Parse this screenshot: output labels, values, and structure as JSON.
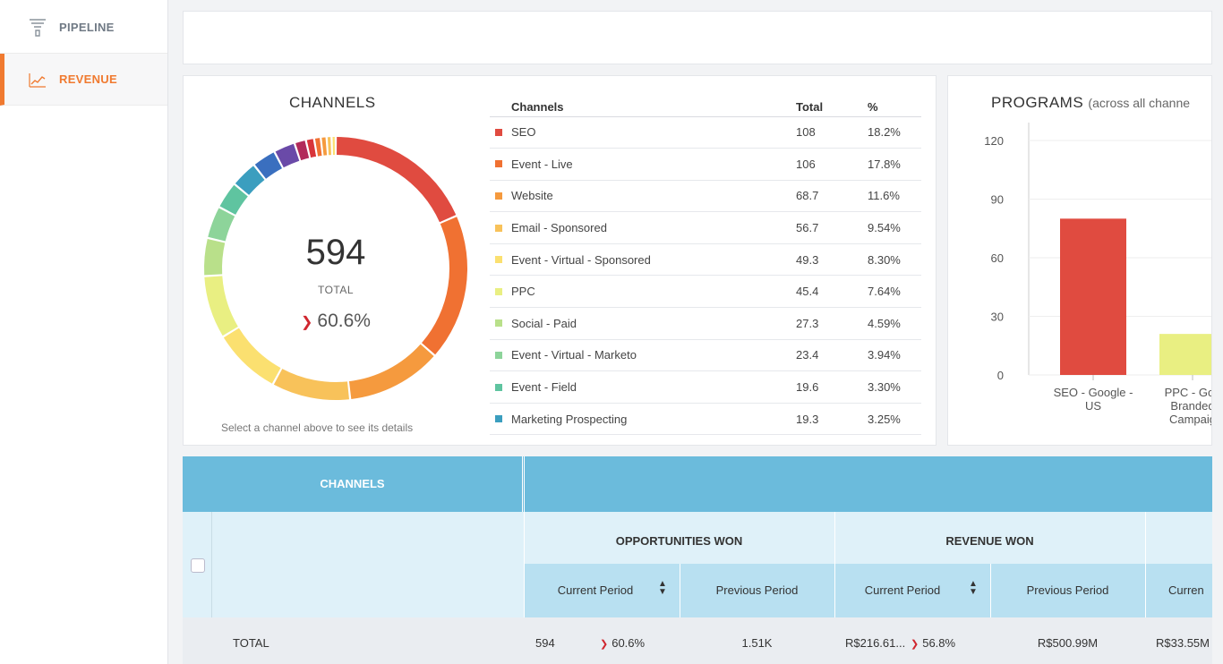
{
  "sidebar": {
    "items": [
      {
        "label": "PIPELINE",
        "icon": "funnel-icon"
      },
      {
        "label": "REVENUE",
        "icon": "trend-line-icon",
        "active": true
      }
    ]
  },
  "channels_card": {
    "title": "CHANNELS",
    "total_value": "594",
    "total_label": "TOTAL",
    "change": "60.6%",
    "change_direction": "down",
    "hint": "Select a channel above to see its details",
    "table_headers": {
      "channel": "Channels",
      "total": "Total",
      "pct": "%"
    },
    "rows": [
      {
        "name": "SEO",
        "total": "108",
        "pct": "18.2%",
        "color": "#e04b40"
      },
      {
        "name": "Event - Live",
        "total": "106",
        "pct": "17.8%",
        "color": "#f07132"
      },
      {
        "name": "Website",
        "total": "68.7",
        "pct": "11.6%",
        "color": "#f59a3e"
      },
      {
        "name": "Email - Sponsored",
        "total": "56.7",
        "pct": "9.54%",
        "color": "#f8c25a"
      },
      {
        "name": "Event - Virtual - Sponsored",
        "total": "49.3",
        "pct": "8.30%",
        "color": "#fbe070"
      },
      {
        "name": "PPC",
        "total": "45.4",
        "pct": "7.64%",
        "color": "#e9ef82"
      },
      {
        "name": "Social - Paid",
        "total": "27.3",
        "pct": "4.59%",
        "color": "#b9e08a"
      },
      {
        "name": "Event - Virtual - Marketo",
        "total": "23.4",
        "pct": "3.94%",
        "color": "#8dd49a"
      },
      {
        "name": "Event - Field",
        "total": "19.6",
        "pct": "3.30%",
        "color": "#5fc4a0"
      },
      {
        "name": "Marketing Prospecting",
        "total": "19.3",
        "pct": "3.25%",
        "color": "#3b9ebf"
      }
    ]
  },
  "chart_data": {
    "type": "bar",
    "title": "PROGRAMS",
    "subtitle": "(across all channe",
    "categories": [
      "SEO - Google - US",
      "PPC - Goo Branded Campaig"
    ],
    "category_lines": [
      [
        "SEO - Google -",
        "US"
      ],
      [
        "PPC - Goo",
        "Branded",
        "Campaig"
      ]
    ],
    "values": [
      80,
      21
    ],
    "colors": [
      "#e04b40",
      "#e9ef82"
    ],
    "yticks": [
      "120",
      "90",
      "60",
      "30",
      "0"
    ],
    "ylim": [
      0,
      120
    ],
    "grid": true
  },
  "donut_slices": [
    {
      "pct": 18.2,
      "color": "#e04b40"
    },
    {
      "pct": 17.8,
      "color": "#f07132"
    },
    {
      "pct": 11.6,
      "color": "#f59a3e"
    },
    {
      "pct": 9.54,
      "color": "#f8c25a"
    },
    {
      "pct": 8.3,
      "color": "#fbe070"
    },
    {
      "pct": 7.64,
      "color": "#e9ef82"
    },
    {
      "pct": 4.59,
      "color": "#b9e08a"
    },
    {
      "pct": 3.94,
      "color": "#8dd49a"
    },
    {
      "pct": 3.3,
      "color": "#5fc4a0"
    },
    {
      "pct": 3.25,
      "color": "#3b9ebf"
    },
    {
      "pct": 2.9,
      "color": "#3a6fbf"
    },
    {
      "pct": 2.6,
      "color": "#6a4aa8"
    },
    {
      "pct": 1.4,
      "color": "#b22a5a"
    },
    {
      "pct": 1.0,
      "color": "#d8343a"
    },
    {
      "pct": 0.8,
      "color": "#f07132"
    },
    {
      "pct": 0.7,
      "color": "#f59a3e"
    },
    {
      "pct": 0.6,
      "color": "#f8c25a"
    },
    {
      "pct": 0.5,
      "color": "#fbe070"
    }
  ],
  "grid_table": {
    "channels_header": "CHANNELS",
    "groups": [
      "OPPORTUNITIES WON",
      "REVENUE WON"
    ],
    "subheaders": [
      "Current Period",
      "Previous Period",
      "Current Period",
      "Previous Period",
      "Curren"
    ],
    "total_row": {
      "label": "TOTAL",
      "opp_current": "594",
      "opp_change": "60.6%",
      "opp_previous": "1.51K",
      "rev_current": "R$216.61...",
      "rev_change": "56.8%",
      "rev_previous": "R$500.99M",
      "next_current": "R$33.55M"
    }
  }
}
